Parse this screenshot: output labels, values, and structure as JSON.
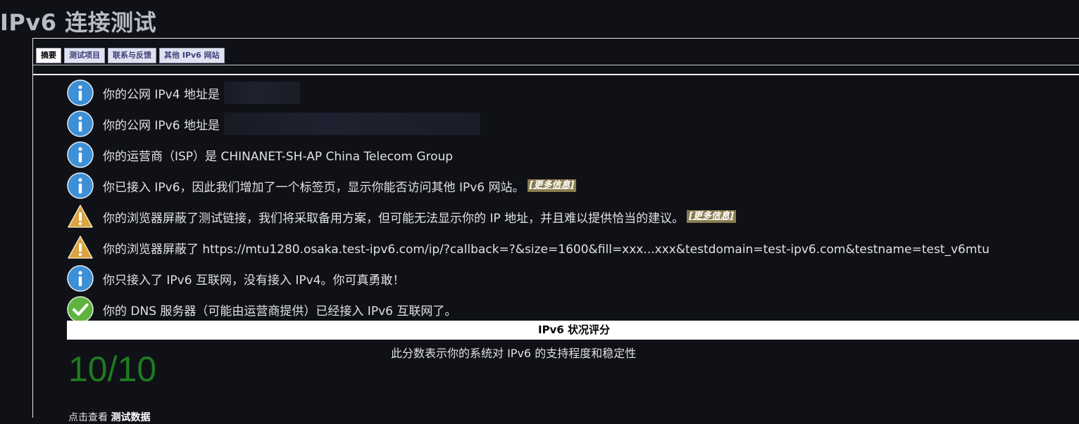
{
  "page": {
    "title": "IPv6 连接测试"
  },
  "tabs": [
    {
      "label": "摘要",
      "active": true
    },
    {
      "label": "测试项目",
      "active": false
    },
    {
      "label": "联系与反馈",
      "active": false
    },
    {
      "label": "其他 IPv6 网站",
      "active": false
    }
  ],
  "messages": [
    {
      "icon": "info-icon",
      "text": "你的公网 IPv4 地址是"
    },
    {
      "icon": "info-icon",
      "text": "你的公网 IPv6 地址是"
    },
    {
      "icon": "info-icon",
      "text": "你的运营商（ISP）是 CHINANET-SH-AP China Telecom Group"
    },
    {
      "icon": "info-icon",
      "text": "你已接入 IPv6，因此我们增加了一个标签页，显示你能否访问其他 IPv6 网站。",
      "link": "[更多信息]"
    },
    {
      "icon": "warning-icon",
      "text": "你的浏览器屏蔽了测试链接，我们将采取备用方案，但可能无法显示你的 IP 地址，并且难以提供恰当的建议。",
      "link": "[更多信息]"
    },
    {
      "icon": "warning-icon",
      "text": "你的浏览器屏蔽了 https://mtu1280.osaka.test-ipv6.com/ip/?callback=?&size=1600&fill=xxx...xxx&testdomain=test-ipv6.com&testname=test_v6mtu"
    },
    {
      "icon": "info-icon",
      "text": "你只接入了 IPv6 互联网，没有接入 IPv4。你可真勇敢！"
    },
    {
      "icon": "check-icon",
      "text": "你的 DNS 服务器（可能由运营商提供）已经接入 IPv6 互联网了。"
    }
  ],
  "score": {
    "heading": "IPv6 状况评分",
    "description": "此分数表示你的系统对 IPv6 的支持程度和稳定性",
    "value": "10/10",
    "value_color": "#1f7a1f"
  },
  "footer": {
    "prefix": "点击查看",
    "link": "测试数据"
  },
  "colors": {
    "info": "#3d8fd6",
    "warning": "#d9a441",
    "check": "#5fb33f",
    "link_bg": "#8a7c4e"
  }
}
